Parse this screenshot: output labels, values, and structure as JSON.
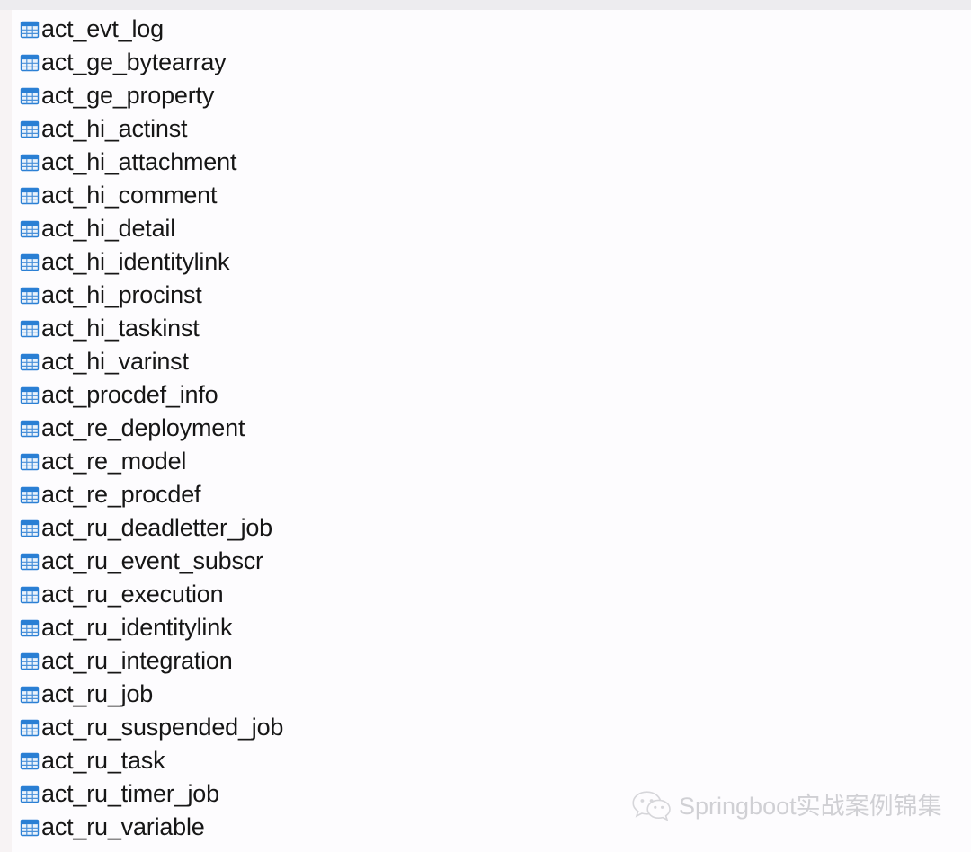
{
  "window": {
    "background_color": "#fdfcfe",
    "top_strip_color": "#edecef",
    "left_band_color": "#f7f3f4"
  },
  "table_list": {
    "icon_name": "database-table-icon",
    "icon_colors": {
      "header": "#2a7fd4",
      "grid": "#4a90d9",
      "cell": "#eaf2fb",
      "border": "#2a7fd4"
    },
    "text_color": "#161616",
    "items": [
      {
        "label": "act_evt_log"
      },
      {
        "label": "act_ge_bytearray"
      },
      {
        "label": "act_ge_property"
      },
      {
        "label": "act_hi_actinst"
      },
      {
        "label": "act_hi_attachment"
      },
      {
        "label": "act_hi_comment"
      },
      {
        "label": "act_hi_detail"
      },
      {
        "label": "act_hi_identitylink"
      },
      {
        "label": "act_hi_procinst"
      },
      {
        "label": "act_hi_taskinst"
      },
      {
        "label": "act_hi_varinst"
      },
      {
        "label": "act_procdef_info"
      },
      {
        "label": "act_re_deployment"
      },
      {
        "label": "act_re_model"
      },
      {
        "label": "act_re_procdef"
      },
      {
        "label": "act_ru_deadletter_job"
      },
      {
        "label": "act_ru_event_subscr"
      },
      {
        "label": "act_ru_execution"
      },
      {
        "label": "act_ru_identitylink"
      },
      {
        "label": "act_ru_integration"
      },
      {
        "label": "act_ru_job"
      },
      {
        "label": "act_ru_suspended_job"
      },
      {
        "label": "act_ru_task"
      },
      {
        "label": "act_ru_timer_job"
      },
      {
        "label": "act_ru_variable"
      }
    ]
  },
  "watermark": {
    "icon_name": "wechat-logo-icon",
    "text": "Springboot实战案例锦集",
    "color": "#cfcfd3"
  }
}
